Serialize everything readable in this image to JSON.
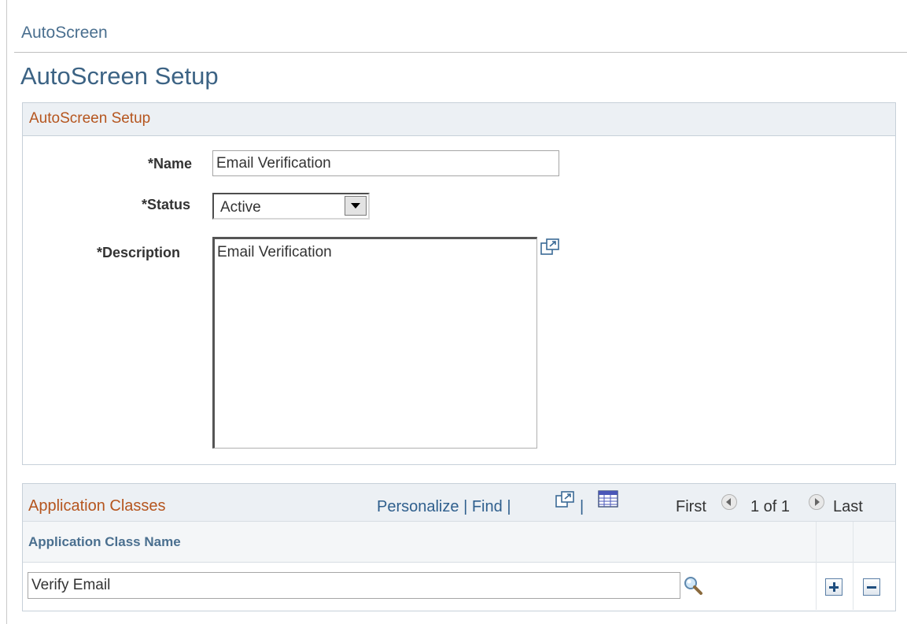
{
  "breadcrumb": "AutoScreen",
  "page_title": "AutoScreen Setup",
  "setup_group": {
    "title": "AutoScreen Setup",
    "name_label": "*Name",
    "name_value": "Email Verification",
    "status_label": "*Status",
    "status_value": "Active",
    "description_label": "*Description",
    "description_value": "Email Verification"
  },
  "app_classes": {
    "title": "Application Classes",
    "personalize": "Personalize",
    "separator": "|",
    "find": "Find",
    "first": "First",
    "range": "1 of 1",
    "last": "Last",
    "column_header": "Application Class Name",
    "rows": [
      {
        "class_name": "Verify Email"
      }
    ]
  },
  "colors": {
    "link": "#2f5f8d",
    "group_title": "#b5551e",
    "header_bg": "#ecf0f4"
  },
  "icons": [
    "expand-icon",
    "view-all-icon",
    "download-icon",
    "previous-icon",
    "next-icon",
    "lookup-icon",
    "add-row-icon",
    "delete-row-icon"
  ]
}
